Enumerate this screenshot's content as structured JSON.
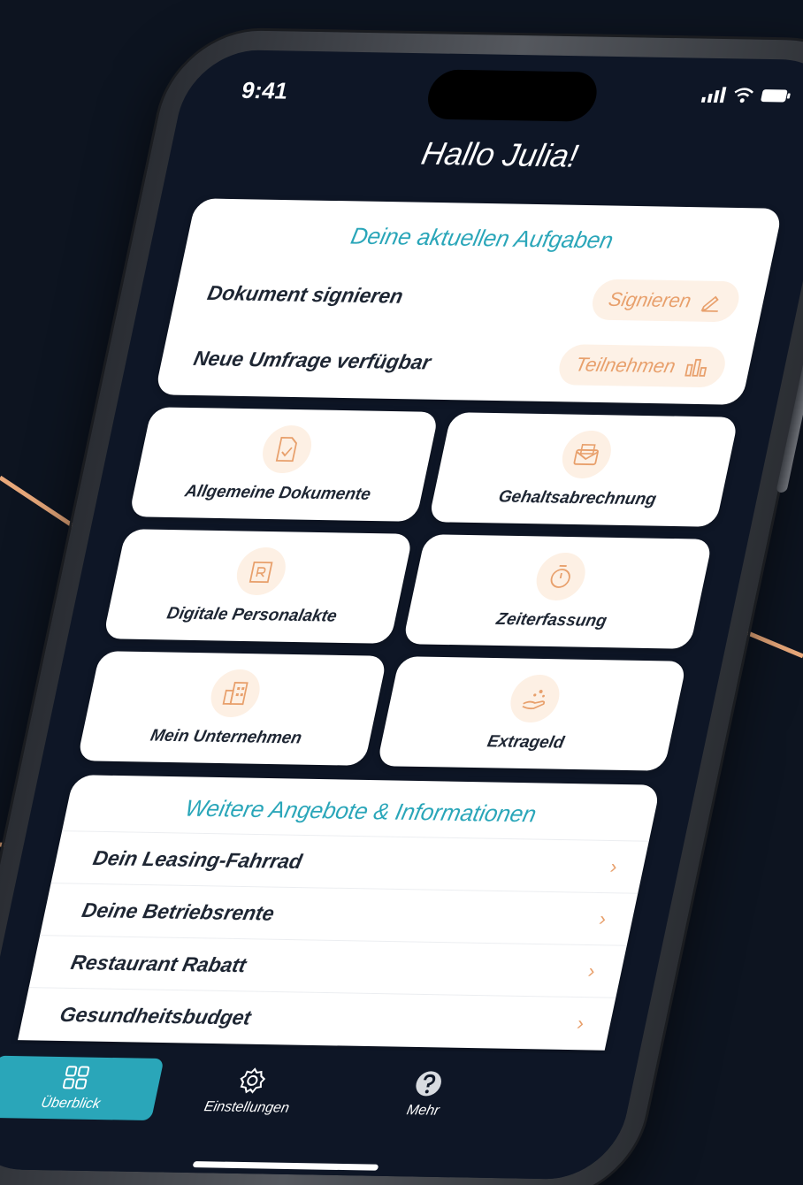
{
  "status_bar": {
    "time": "9:41"
  },
  "greeting": "Hallo Julia!",
  "tasks": {
    "heading": "Deine aktuellen Aufgaben",
    "items": [
      {
        "label": "Dokument signieren",
        "action": "Signieren",
        "icon": "pencil-icon"
      },
      {
        "label": "Neue Umfrage verfügbar",
        "action": "Teilnehmen",
        "icon": "bar-chart-icon"
      }
    ]
  },
  "tiles": [
    {
      "label": "Allgemeine Dokumente",
      "icon": "document-check-icon"
    },
    {
      "label": "Gehaltsabrechnung",
      "icon": "envelope-icon"
    },
    {
      "label": "Digitale Personalakte",
      "icon": "personnel-file-icon"
    },
    {
      "label": "Zeiterfassung",
      "icon": "stopwatch-icon"
    },
    {
      "label": "Mein Unternehmen",
      "icon": "building-icon"
    },
    {
      "label": "Extrageld",
      "icon": "hand-coins-icon"
    }
  ],
  "offers": {
    "heading": "Weitere Angebote & Informationen",
    "items": [
      {
        "label": "Dein Leasing-Fahrrad"
      },
      {
        "label": "Deine Betriebsrente"
      },
      {
        "label": "Restaurant Rabatt"
      },
      {
        "label": "Gesundheitsbudget"
      }
    ],
    "chevron": "›"
  },
  "tabbar": {
    "items": [
      {
        "label": "Überblick",
        "icon": "grid-icon",
        "active": true
      },
      {
        "label": "Einstellungen",
        "icon": "gear-icon",
        "active": false
      },
      {
        "label": "Mehr",
        "icon": "help-icon",
        "active": false
      }
    ]
  },
  "colors": {
    "background": "#0d1420",
    "screen": "#0e1626",
    "accent_teal": "#2aa6b9",
    "accent_orange": "#e8a06c",
    "arrow": "#e8a87a"
  }
}
